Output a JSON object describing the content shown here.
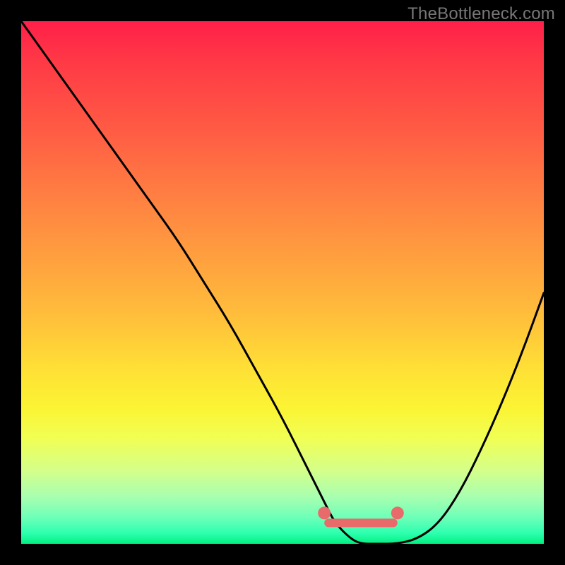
{
  "watermark": "TheBottleneck.com",
  "chart_data": {
    "type": "line",
    "title": "",
    "xlabel": "",
    "ylabel": "",
    "xlim": [
      0,
      100
    ],
    "ylim": [
      0,
      100
    ],
    "grid": false,
    "legend": null,
    "series": [
      {
        "name": "curve",
        "x": [
          0,
          5,
          10,
          15,
          20,
          25,
          30,
          35,
          40,
          45,
          50,
          55,
          58,
          60,
          63,
          65,
          68,
          72,
          76,
          80,
          84,
          88,
          92,
          96,
          100
        ],
        "y": [
          100,
          93,
          86,
          79,
          72,
          65,
          58,
          50,
          42,
          33,
          24,
          14,
          8,
          4,
          1,
          0,
          0,
          0,
          1,
          4,
          10,
          18,
          27,
          37,
          48
        ]
      }
    ],
    "annotations": {
      "highlight_range_x": [
        58,
        72
      ],
      "highlight_y": 4
    },
    "background_gradient": {
      "direction": "vertical",
      "stops": [
        {
          "pos": 0.0,
          "color": "#ff1f49"
        },
        {
          "pos": 0.45,
          "color": "#ff9c3f"
        },
        {
          "pos": 0.7,
          "color": "#ffde36"
        },
        {
          "pos": 0.88,
          "color": "#d4ff8a"
        },
        {
          "pos": 1.0,
          "color": "#00f07f"
        }
      ]
    }
  }
}
